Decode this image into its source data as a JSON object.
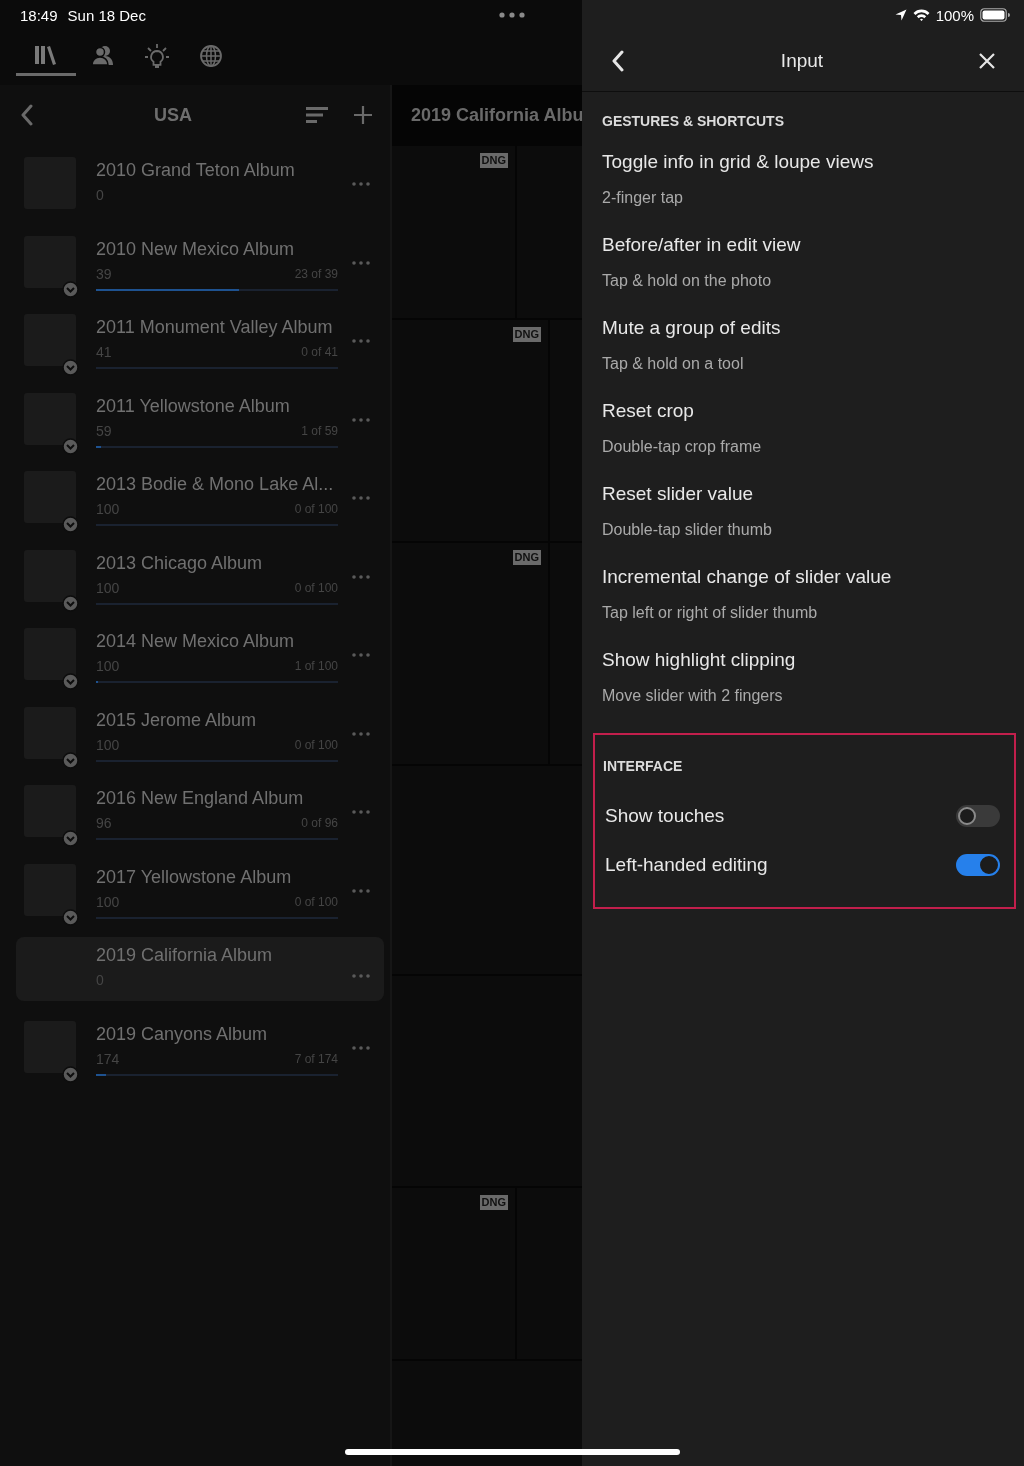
{
  "status_bar": {
    "time": "18:49",
    "date": "Sun 18 Dec",
    "battery": "100%"
  },
  "nav_tabs": [
    {
      "kind": "library",
      "selected": true
    },
    {
      "kind": "people",
      "selected": false
    },
    {
      "kind": "bulb",
      "selected": false
    },
    {
      "kind": "globe",
      "selected": false
    }
  ],
  "sidebar": {
    "title": "USA",
    "albums": [
      {
        "name": "2010 Grand Teton Album",
        "count": "0",
        "badge": false,
        "selected": false
      },
      {
        "name": "2010 New Mexico Album",
        "count": "39",
        "progress": "23 of 39",
        "level": 0.59,
        "badge": true,
        "selected": false
      },
      {
        "name": "2011 Monument Valley Album",
        "count": "41",
        "progress": "0 of 41",
        "level": 0,
        "badge": true,
        "selected": false
      },
      {
        "name": "2011 Yellowstone Album",
        "count": "59",
        "progress": "1 of 59",
        "level": 0.02,
        "badge": true,
        "selected": false
      },
      {
        "name": "2013 Bodie & Mono Lake Al...",
        "count": "100",
        "progress": "0 of 100",
        "level": 0,
        "badge": true,
        "selected": false
      },
      {
        "name": "2013 Chicago Album",
        "count": "100",
        "progress": "0 of 100",
        "level": 0,
        "badge": true,
        "selected": false
      },
      {
        "name": "2014 New Mexico Album",
        "count": "100",
        "progress": "1 of 100",
        "level": 0.01,
        "badge": true,
        "selected": false
      },
      {
        "name": "2015 Jerome Album",
        "count": "100",
        "progress": "0 of 100",
        "level": 0,
        "badge": true,
        "selected": false
      },
      {
        "name": "2016 New England Album",
        "count": "96",
        "progress": "0 of 96",
        "level": 0,
        "badge": true,
        "selected": false
      },
      {
        "name": "2017 Yellowstone Album",
        "count": "100",
        "progress": "0 of 100",
        "level": 0,
        "badge": true,
        "selected": false
      },
      {
        "name": "2019 California Album",
        "count": "0",
        "badge": false,
        "selected": true
      },
      {
        "name": "2019 Canyons Album",
        "count": "174",
        "progress": "7 of 174",
        "level": 0.04,
        "badge": true,
        "selected": false
      }
    ]
  },
  "album_view": {
    "title": "2019 California Albu",
    "grid": [
      {
        "kind": "split-a",
        "badge": "DNG"
      },
      {
        "kind": "split-b",
        "badge": "DNG"
      },
      {
        "kind": "split-b",
        "badge": "DNG"
      },
      {
        "kind": "full"
      },
      {
        "kind": "full"
      },
      {
        "kind": "split-a",
        "badge": "DNG"
      },
      {
        "kind": "full"
      }
    ]
  },
  "panel": {
    "title": "Input",
    "sections": [
      {
        "heading": "GESTURES & SHORTCUTS",
        "highlighted": false,
        "items": [
          {
            "kind": "shortcut",
            "title": "Toggle info in grid & loupe views",
            "description": "2-finger tap"
          },
          {
            "kind": "shortcut",
            "title": "Before/after in edit view",
            "description": "Tap & hold on the photo"
          },
          {
            "kind": "shortcut",
            "title": "Mute a group of edits",
            "description": "Tap & hold on a tool"
          },
          {
            "kind": "shortcut",
            "title": "Reset crop",
            "description": "Double-tap crop frame"
          },
          {
            "kind": "shortcut",
            "title": "Reset slider value",
            "description": "Double-tap slider thumb"
          },
          {
            "kind": "shortcut",
            "title": "Incremental change of slider value",
            "description": "Tap left or right of slider thumb"
          },
          {
            "kind": "shortcut",
            "title": "Show highlight clipping",
            "description": "Move slider with 2 fingers"
          }
        ]
      },
      {
        "heading": "INTERFACE",
        "highlighted": true,
        "items": [
          {
            "kind": "toggle",
            "label": "Show touches",
            "on": false
          },
          {
            "kind": "toggle",
            "label": "Left-handed editing",
            "on": true
          }
        ]
      }
    ]
  }
}
